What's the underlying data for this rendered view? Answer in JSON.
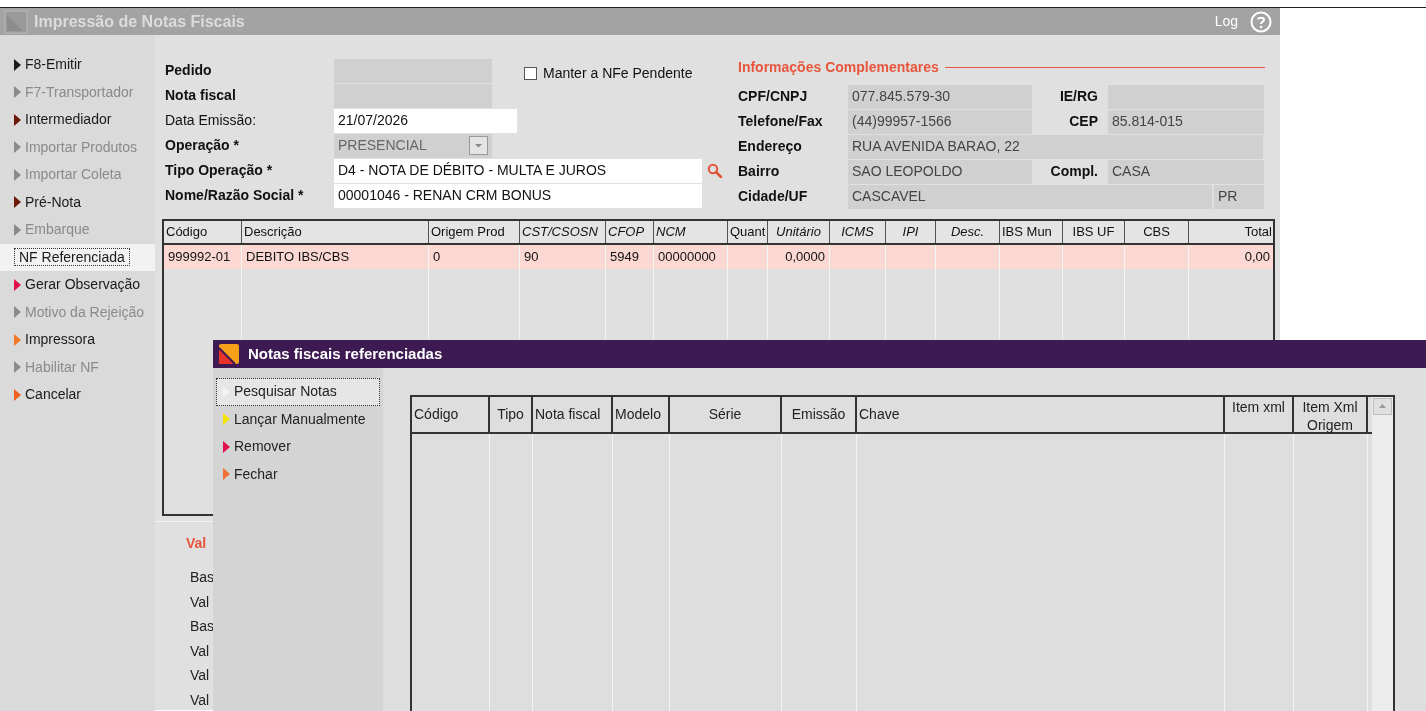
{
  "window": {
    "title": "Impressão de Notas Fiscais",
    "log_label": "Log"
  },
  "sidebar": {
    "items": [
      {
        "label": "F8-Emitir",
        "color": "#1a1a1a",
        "disabled": false,
        "selected": false
      },
      {
        "label": "F7-Transportador",
        "color": "#8a8a8a",
        "disabled": true,
        "selected": false
      },
      {
        "label": "Intermediador",
        "color": "#6e1808",
        "disabled": false,
        "selected": false
      },
      {
        "label": "Importar Produtos",
        "color": "#8a8a8a",
        "disabled": true,
        "selected": false
      },
      {
        "label": "Importar Coleta",
        "color": "#8a8a8a",
        "disabled": true,
        "selected": false
      },
      {
        "label": "Pré-Nota",
        "color": "#6e1808",
        "disabled": false,
        "selected": false
      },
      {
        "label": "Embarque",
        "color": "#8a8a8a",
        "disabled": true,
        "selected": false
      },
      {
        "label": "NF Referenciada",
        "disabled": false,
        "selected": true
      },
      {
        "label": "Gerar Observação",
        "color": "#e0104a",
        "disabled": false,
        "selected": false
      },
      {
        "label": "Motivo da Rejeição",
        "color": "#8a8a8a",
        "disabled": true,
        "selected": false
      },
      {
        "label": "Impressora",
        "color": "#f07a2a",
        "disabled": false,
        "selected": false
      },
      {
        "label": "Habilitar NF",
        "color": "#8a8a8a",
        "disabled": true,
        "selected": false
      },
      {
        "label": "Cancelar",
        "color": "#f06020",
        "disabled": false,
        "selected": false
      }
    ]
  },
  "form": {
    "fields": [
      {
        "kind": "field",
        "label": "Pedido",
        "bold": true,
        "editable": false
      },
      {
        "kind": "field",
        "label": "Nota fiscal",
        "bold": true,
        "editable": false
      },
      {
        "kind": "field",
        "label": "Data Emissão:",
        "bold": false,
        "editable": true,
        "value": "21/07/2026"
      },
      {
        "kind": "select",
        "label": "Operação *",
        "bold": true,
        "editable": false,
        "value": "PRESENCIAL"
      },
      {
        "kind": "search",
        "label": "Tipo Operação *",
        "bold": true,
        "editable": true,
        "value": "D4 - NOTA DE DÉBITO - MULTA E JUROS"
      },
      {
        "kind": "field",
        "label": "Nome/Razão Social *",
        "bold": true,
        "editable": true,
        "value": "00001046 - RENAN CRM BONUS"
      }
    ],
    "keep_pending": {
      "label": "Manter a NFe Pendente",
      "checked": false
    }
  },
  "info": {
    "title": "Informações Complementares",
    "rows": [
      {
        "label": "CPF/CNPJ",
        "value": "077.845.579-30",
        "label_2": "IE/RG"
      },
      {
        "label": "Telefone/Fax",
        "value": "(44)99957-1566",
        "label_2": "CEP",
        "value_2": "85.814-015"
      },
      {
        "label": "Endereço",
        "value": "RUA AVENIDA BARAO, 22"
      },
      {
        "label": "Bairro",
        "value": "SAO LEOPOLDO",
        "label_2": "Compl.",
        "value_2": "CASA"
      },
      {
        "label": "Cidade/UF",
        "value": "CASCAVEL",
        "uf": "PR"
      }
    ]
  },
  "items_table": {
    "columns": [
      {
        "label": "Código",
        "italic": false
      },
      {
        "label": "Descrição",
        "italic": false
      },
      {
        "label": "Origem Prod",
        "italic": false
      },
      {
        "label": "CST/CSOSN",
        "italic": true
      },
      {
        "label": "CFOP",
        "italic": true
      },
      {
        "label": "NCM",
        "italic": true
      },
      {
        "label": "Quant",
        "italic": false
      },
      {
        "label": "Unitário",
        "italic": true
      },
      {
        "label": "ICMS",
        "italic": true
      },
      {
        "label": "IPI",
        "italic": true
      },
      {
        "label": "Desc.",
        "italic": true
      },
      {
        "label": "IBS Mun",
        "italic": false
      },
      {
        "label": "IBS UF",
        "italic": false
      },
      {
        "label": "CBS",
        "italic": false
      },
      {
        "label": "Total",
        "italic": false
      }
    ],
    "rows": [
      {
        "selected": true,
        "cells": [
          "999992-01",
          "DEBITO IBS/CBS",
          "0",
          "90",
          "5949",
          "00000000",
          "",
          "0,0000",
          "",
          "",
          "",
          "",
          "",
          "",
          "0,00"
        ]
      }
    ]
  },
  "totals": {
    "title": "Val",
    "labels": [
      "Bas",
      "Val",
      "Bas",
      "Val",
      "Val",
      "Val"
    ]
  },
  "dialog": {
    "title": "Notas fiscais referenciadas",
    "actions": [
      {
        "label": "Pesquisar Notas",
        "color": "#f4f4f4",
        "selected": true
      },
      {
        "label": "Lançar Manualmente",
        "color": "#f2e400",
        "selected": false
      },
      {
        "label": "Remover",
        "color": "#e0104a",
        "selected": false
      },
      {
        "label": "Fechar",
        "color": "#f07030",
        "selected": false
      }
    ],
    "table": {
      "columns": [
        "Código",
        "Tipo",
        "Nota fiscal",
        "Modelo",
        "Série",
        "Emissão",
        "Chave",
        "Item xml",
        "Item Xml Origem"
      ]
    }
  }
}
